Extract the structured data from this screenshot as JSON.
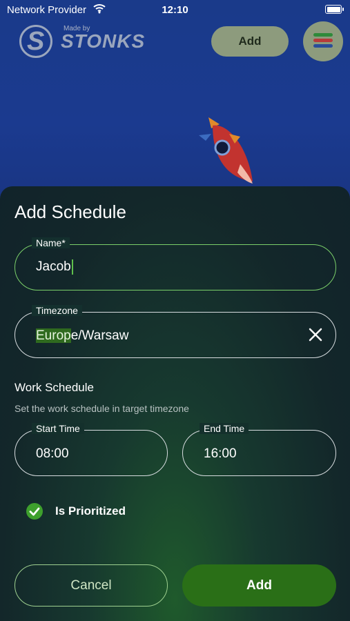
{
  "status_bar": {
    "carrier": "Network Provider",
    "time": "12:10"
  },
  "logo": {
    "made_by": "Made by",
    "brand": "STONKS"
  },
  "header": {
    "add_label": "Add"
  },
  "sheet": {
    "title": "Add Schedule",
    "name_field": {
      "label": "Name*",
      "value": "Jacob"
    },
    "timezone_field": {
      "label": "Timezone",
      "value_highlight": "Europ",
      "value_rest": "e/Warsaw"
    },
    "work_schedule": {
      "title": "Work Schedule",
      "subtitle": "Set the work schedule in target timezone",
      "start": {
        "label": "Start Time",
        "value": "08:00"
      },
      "end": {
        "label": "End Time",
        "value": "16:00"
      }
    },
    "prioritized": {
      "label": "Is Prioritized",
      "checked": true
    },
    "cancel_label": "Cancel",
    "add_label": "Add"
  },
  "colors": {
    "accent": "#2a6f17",
    "focus_border": "#7bd06a",
    "background": "#1a3a8a"
  }
}
